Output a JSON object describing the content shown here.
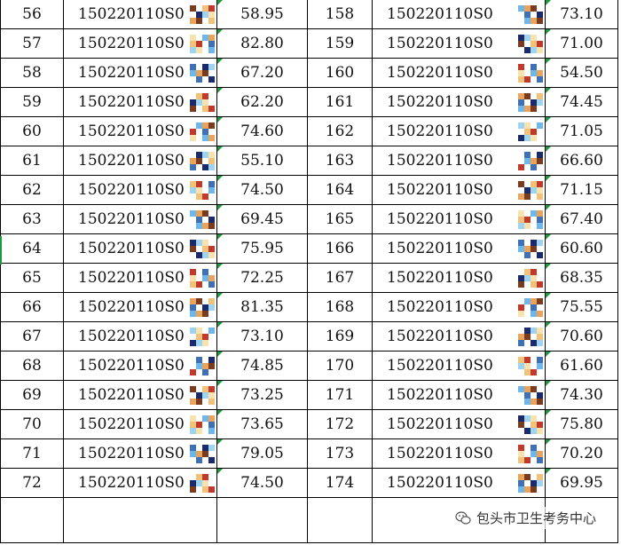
{
  "rows": [
    {
      "no_l": "56",
      "id_l": "150220110S0",
      "score_l": "58.95",
      "no_r": "158",
      "id_r": "150220110S0",
      "score_r": "73.10"
    },
    {
      "no_l": "57",
      "id_l": "150220110S0",
      "score_l": "82.80",
      "no_r": "159",
      "id_r": "150220110S0",
      "score_r": "71.00"
    },
    {
      "no_l": "58",
      "id_l": "150220110S0",
      "score_l": "67.20",
      "no_r": "160",
      "id_r": "150220110S0",
      "score_r": "54.50"
    },
    {
      "no_l": "59",
      "id_l": "150220110S0",
      "score_l": "62.20",
      "no_r": "161",
      "id_r": "150220110S0",
      "score_r": "74.45"
    },
    {
      "no_l": "60",
      "id_l": "150220110S0",
      "score_l": "74.60",
      "no_r": "162",
      "id_r": "150220110S0",
      "score_r": "71.05"
    },
    {
      "no_l": "61",
      "id_l": "150220110S0",
      "score_l": "55.10",
      "no_r": "163",
      "id_r": "150220110S0",
      "score_r": "66.60"
    },
    {
      "no_l": "62",
      "id_l": "150220110S0",
      "score_l": "74.50",
      "no_r": "164",
      "id_r": "150220110S0",
      "score_r": "71.15"
    },
    {
      "no_l": "63",
      "id_l": "150220110S0",
      "score_l": "69.45",
      "no_r": "165",
      "id_r": "150220110S0",
      "score_r": "67.40"
    },
    {
      "no_l": "64",
      "id_l": "150220110S0",
      "score_l": "75.95",
      "no_r": "166",
      "id_r": "150220110S0",
      "score_r": "60.60"
    },
    {
      "no_l": "65",
      "id_l": "150220110S0",
      "score_l": "72.25",
      "no_r": "167",
      "id_r": "150220110S0",
      "score_r": "68.35"
    },
    {
      "no_l": "66",
      "id_l": "150220110S0",
      "score_l": "81.35",
      "no_r": "168",
      "id_r": "150220110S0",
      "score_r": "75.55"
    },
    {
      "no_l": "67",
      "id_l": "150220110S0",
      "score_l": "73.10",
      "no_r": "169",
      "id_r": "150220110S0",
      "score_r": "70.60"
    },
    {
      "no_l": "68",
      "id_l": "150220110S0",
      "score_l": "74.85",
      "no_r": "170",
      "id_r": "150220110S0",
      "score_r": "61.60"
    },
    {
      "no_l": "69",
      "id_l": "150220110S0",
      "score_l": "73.25",
      "no_r": "171",
      "id_r": "150220110S0",
      "score_r": "74.30"
    },
    {
      "no_l": "70",
      "id_l": "150220110S0",
      "score_l": "73.65",
      "no_r": "172",
      "id_r": "150220110S0",
      "score_r": "75.80"
    },
    {
      "no_l": "71",
      "id_l": "150220110S0",
      "score_l": "79.05",
      "no_r": "173",
      "id_r": "150220110S0",
      "score_r": "70.20"
    },
    {
      "no_l": "72",
      "id_l": "150220110S0",
      "score_l": "74.50",
      "no_r": "174",
      "id_r": "150220110S0",
      "score_r": "69.95"
    }
  ],
  "watermark": {
    "text": "包头市卫生考务中心",
    "icon": "wechat-icon"
  },
  "colors": {
    "grid": "#000000",
    "error_marker": "#1a9a3a"
  }
}
